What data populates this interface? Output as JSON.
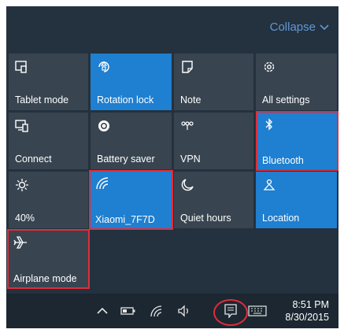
{
  "header": {
    "collapse_label": "Collapse"
  },
  "tiles": [
    {
      "label": "Tablet mode"
    },
    {
      "label": "Rotation lock"
    },
    {
      "label": "Note"
    },
    {
      "label": "All settings"
    },
    {
      "label": "Connect"
    },
    {
      "label": "Battery saver"
    },
    {
      "label": "VPN"
    },
    {
      "label": "Bluetooth"
    },
    {
      "label": "40%"
    },
    {
      "label": "Xiaomi_7F7D"
    },
    {
      "label": "Quiet hours"
    },
    {
      "label": "Location"
    },
    {
      "label": "Airplane mode"
    }
  ],
  "taskbar": {
    "time": "8:51 PM",
    "date": "8/30/2015"
  },
  "colors": {
    "active_tile": "#1f7fd0",
    "inactive_tile": "#384551",
    "highlight": "#e02d3a",
    "accent_text": "#5f98d6"
  }
}
